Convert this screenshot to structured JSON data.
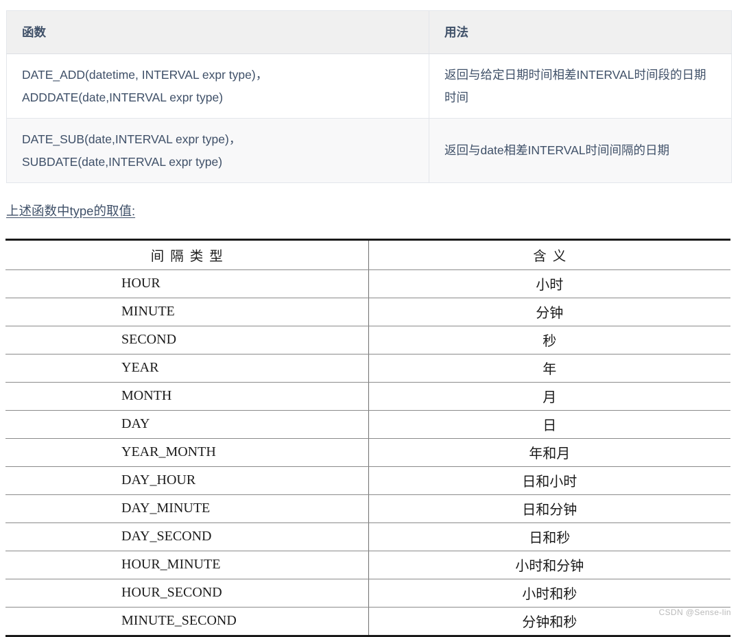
{
  "function_table": {
    "headers": [
      "函数",
      "用法"
    ],
    "rows": [
      {
        "function_lines": [
          "DATE_ADD(datetime, INTERVAL expr type)，",
          "ADDDATE(date,INTERVAL expr type)"
        ],
        "usage": "返回与给定日期时间相差INTERVAL时间段的日期时间"
      },
      {
        "function_lines": [
          "DATE_SUB(date,INTERVAL expr type)，",
          "SUBDATE(date,INTERVAL expr type)"
        ],
        "usage": "返回与date相差INTERVAL时间间隔的日期"
      }
    ]
  },
  "note": "上述函数中type的取值:",
  "type_table": {
    "headers": [
      "间隔类型",
      "含义"
    ],
    "rows": [
      {
        "type": "HOUR",
        "meaning": "小时"
      },
      {
        "type": "MINUTE",
        "meaning": "分钟"
      },
      {
        "type": "SECOND",
        "meaning": "秒"
      },
      {
        "type": "YEAR",
        "meaning": "年"
      },
      {
        "type": "MONTH",
        "meaning": "月"
      },
      {
        "type": "DAY",
        "meaning": "日"
      },
      {
        "type": "YEAR_MONTH",
        "meaning": "年和月"
      },
      {
        "type": "DAY_HOUR",
        "meaning": "日和小时"
      },
      {
        "type": "DAY_MINUTE",
        "meaning": "日和分钟"
      },
      {
        "type": "DAY_SECOND",
        "meaning": "日和秒"
      },
      {
        "type": "HOUR_MINUTE",
        "meaning": "小时和分钟"
      },
      {
        "type": "HOUR_SECOND",
        "meaning": "小时和秒"
      },
      {
        "type": "MINUTE_SECOND",
        "meaning": "分钟和秒"
      }
    ]
  },
  "watermark": "CSDN @Sense-lin",
  "colors": {
    "header_bg": "#f0f0f0",
    "text_blue": "#3f5068",
    "border_light": "#e3e6eb",
    "alt_row": "#f8f8f9",
    "rule_dark": "#1a1a1a",
    "rule_gray": "#8a8a8a",
    "watermark": "#b9b9b9"
  }
}
